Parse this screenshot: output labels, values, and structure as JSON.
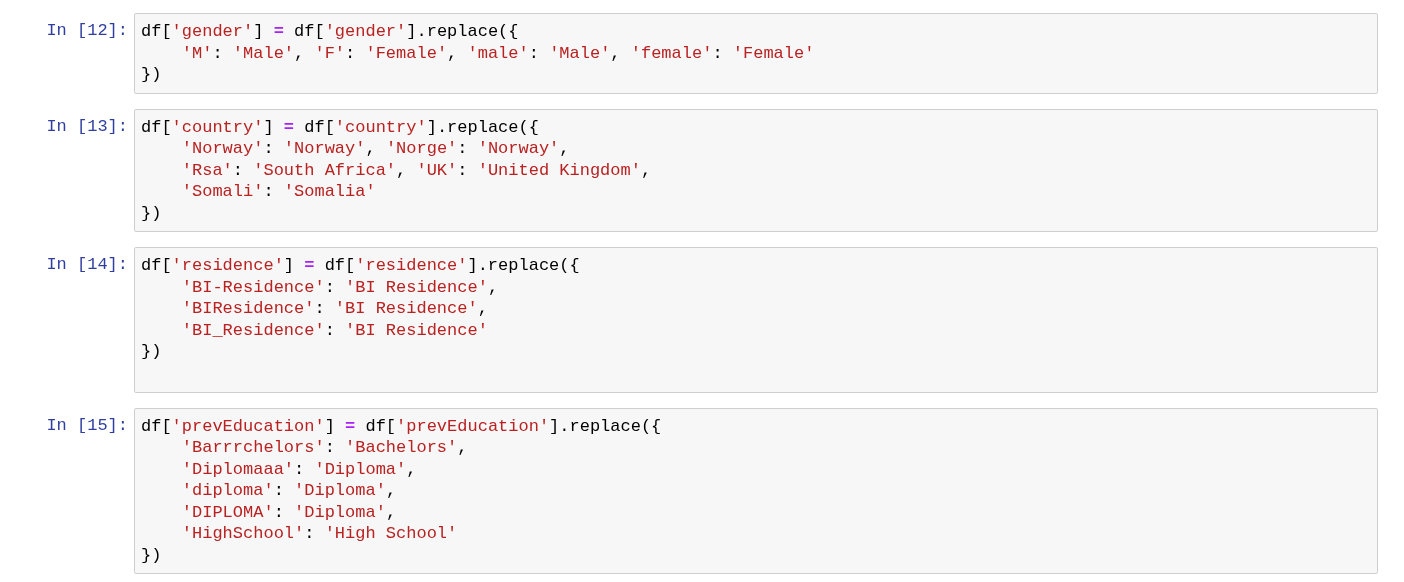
{
  "cells": [
    {
      "prompt": "In [12]:",
      "trailing_blank": false,
      "lines": [
        "df['gender'] = df['gender'].replace({",
        "    'M': 'Male', 'F': 'Female', 'male': 'Male', 'female': 'Female'",
        "})"
      ]
    },
    {
      "prompt": "In [13]:",
      "trailing_blank": false,
      "lines": [
        "df['country'] = df['country'].replace({",
        "    'Norway': 'Norway', 'Norge': 'Norway',",
        "    'Rsa': 'South Africa', 'UK': 'United Kingdom',",
        "    'Somali': 'Somalia'",
        "})"
      ]
    },
    {
      "prompt": "In [14]:",
      "trailing_blank": true,
      "lines": [
        "df['residence'] = df['residence'].replace({",
        "    'BI-Residence': 'BI Residence',",
        "    'BIResidence': 'BI Residence',",
        "    'BI_Residence': 'BI Residence'",
        "})"
      ]
    },
    {
      "prompt": "In [15]:",
      "trailing_blank": false,
      "lines": [
        "df['prevEducation'] = df['prevEducation'].replace({",
        "    'Barrrchelors': 'Bachelors',",
        "    'Diplomaaa': 'Diploma',",
        "    'diploma': 'Diploma',",
        "    'DIPLOMA': 'Diploma',",
        "    'HighSchool': 'High School'",
        "})"
      ]
    }
  ]
}
